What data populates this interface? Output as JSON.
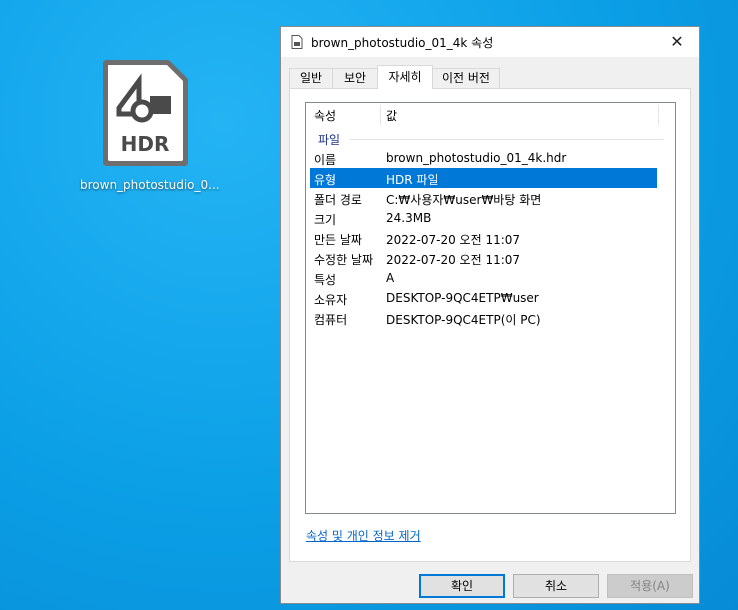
{
  "desktop": {
    "icon_badge": "HDR",
    "icon_label": "brown_photostudio_0..."
  },
  "dialog": {
    "title": "brown_photostudio_01_4k 속성",
    "close_glyph": "✕",
    "tabs": [
      {
        "label": "일반"
      },
      {
        "label": "보안"
      },
      {
        "label": "자세히"
      },
      {
        "label": "이전 버전"
      }
    ],
    "active_tab": "자세히",
    "columns": {
      "property": "속성",
      "value": "값"
    },
    "group_label": "파일",
    "rows": [
      {
        "key": "이름",
        "value": "brown_photostudio_01_4k.hdr"
      },
      {
        "key": "유형",
        "value": "HDR 파일"
      },
      {
        "key": "폴더 경로",
        "value": "C:₩사용자₩user₩바탕 화면"
      },
      {
        "key": "크기",
        "value": "24.3MB"
      },
      {
        "key": "만든 날짜",
        "value": "2022-07-20 오전 11:07"
      },
      {
        "key": "수정한 날짜",
        "value": "2022-07-20 오전 11:07"
      },
      {
        "key": "특성",
        "value": "A"
      },
      {
        "key": "소유자",
        "value": "DESKTOP-9QC4ETP₩user"
      },
      {
        "key": "컴퓨터",
        "value": "DESKTOP-9QC4ETP(이 PC)"
      }
    ],
    "selected_row": "유형",
    "remove_link": "속성 및 개인 정보 제거",
    "buttons": {
      "ok": "확인",
      "cancel": "취소",
      "apply": "적용(A)"
    }
  },
  "colors": {
    "selection": "#0078d7",
    "link": "#0066cc",
    "desktop": "#0b9fe6"
  }
}
